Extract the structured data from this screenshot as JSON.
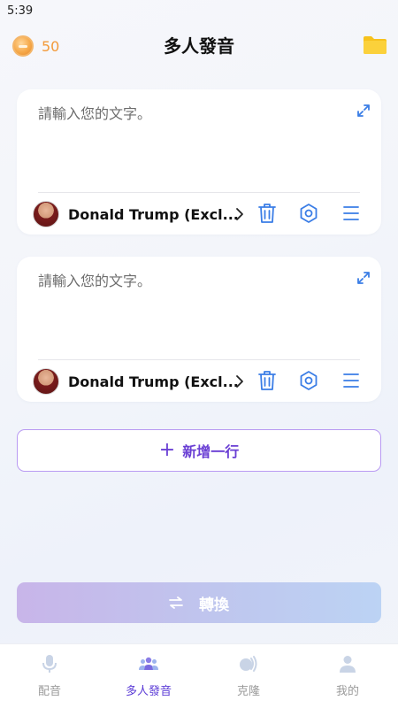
{
  "status_bar": {
    "time": "5:39"
  },
  "header": {
    "coins": "50",
    "title": "多人發音",
    "folder_icon": "folder-icon"
  },
  "cards": [
    {
      "placeholder": "請輸入您的文字。",
      "voice_name": "Donald Trump (Excl..."
    },
    {
      "placeholder": "請輸入您的文字。",
      "voice_name": "Donald Trump (Excl..."
    }
  ],
  "add_line": {
    "label": "新增一行"
  },
  "convert": {
    "label": "轉換"
  },
  "tabs": [
    {
      "label": "配音",
      "icon": "microphone-icon",
      "active": false
    },
    {
      "label": "多人發音",
      "icon": "people-icon",
      "active": true
    },
    {
      "label": "克隆",
      "icon": "sound-wave-icon",
      "active": false
    },
    {
      "label": "我的",
      "icon": "user-icon",
      "active": false
    }
  ],
  "colors": {
    "accent_purple": "#5b3bd6",
    "icon_blue": "#3a7de6",
    "coin_orange": "#f39a3a",
    "folder_yellow": "#f7c21c"
  }
}
